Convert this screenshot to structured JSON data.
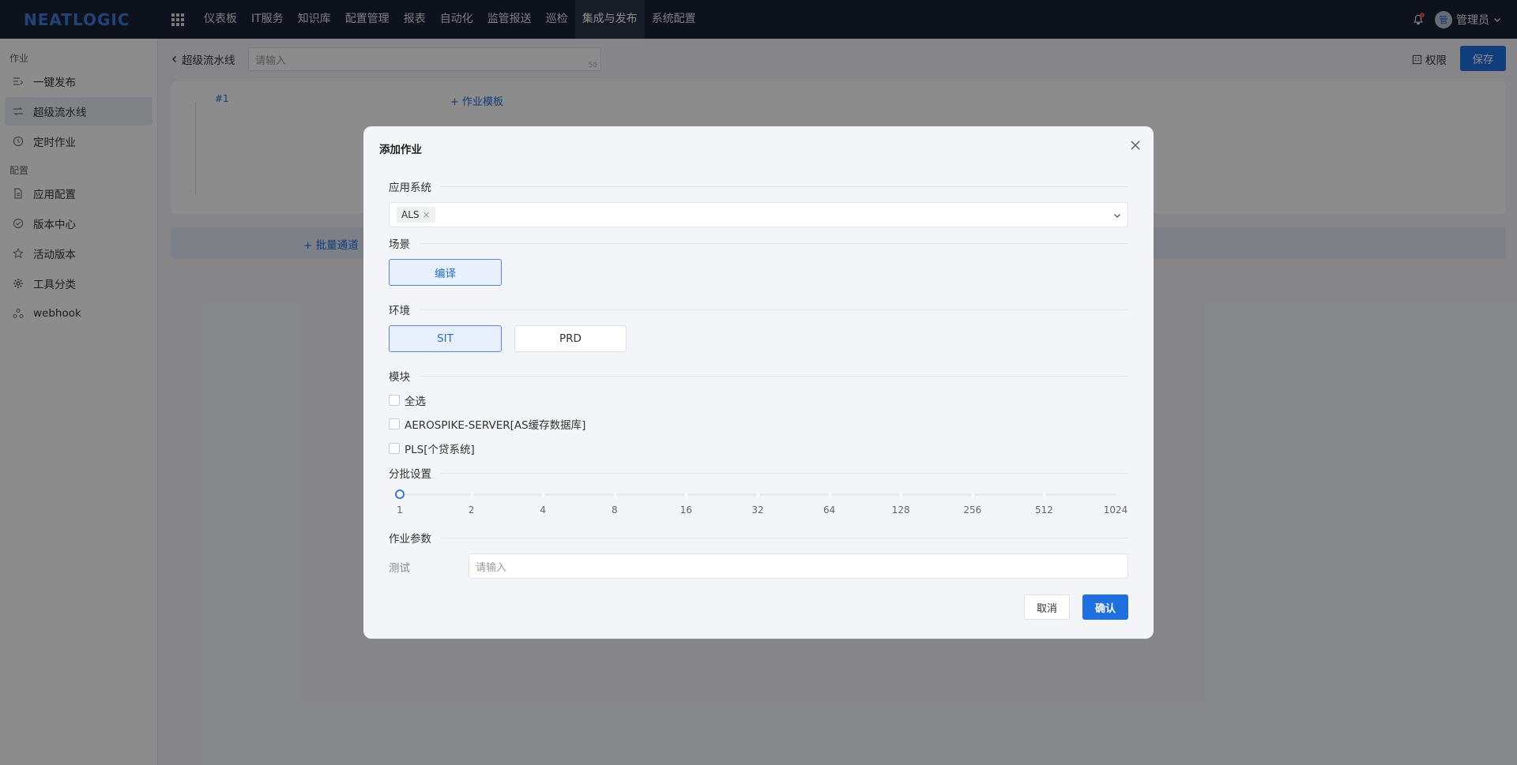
{
  "topbar": {
    "logo": "NEATLOGIC",
    "nav": [
      "仪表板",
      "IT服务",
      "知识库",
      "配置管理",
      "报表",
      "自动化",
      "监管报送",
      "巡检",
      "集成与发布",
      "系统配置"
    ],
    "active_nav": "集成与发布",
    "user_avatar": "管",
    "user_name": "管理员"
  },
  "sidebar": {
    "group1": "作业",
    "items1": [
      {
        "label": "一键发布",
        "icon": "publish-icon"
      },
      {
        "label": "超级流水线",
        "icon": "pipeline-icon",
        "active": true
      },
      {
        "label": "定时作业",
        "icon": "clock-icon"
      }
    ],
    "group2": "配置",
    "items2": [
      {
        "label": "应用配置",
        "icon": "file-icon"
      },
      {
        "label": "版本中心",
        "icon": "check-circle-icon"
      },
      {
        "label": "活动版本",
        "icon": "star-icon"
      },
      {
        "label": "工具分类",
        "icon": "gear-icon"
      },
      {
        "label": "webhook",
        "icon": "webhook-icon"
      }
    ]
  },
  "main": {
    "back_label": "超级流水线",
    "title_placeholder": "请输入",
    "title_count": "50",
    "permission_label": "权限",
    "save_label": "保存",
    "stage_number": "#1",
    "template_link": "+ 作业模板",
    "batch_channel": "+ 批量通道"
  },
  "modal": {
    "title": "添加作业",
    "app_system_label": "应用系统",
    "app_system_tag": "ALS",
    "scene_label": "场景",
    "scene_options": [
      {
        "label": "编译",
        "selected": true
      }
    ],
    "env_label": "环境",
    "env_options": [
      {
        "label": "SIT",
        "selected": true
      },
      {
        "label": "PRD",
        "selected": false
      }
    ],
    "module_label": "模块",
    "modules": [
      "全选",
      "AEROSPIKE-SERVER[AS缓存数据库]",
      "PLS[个贷系统]"
    ],
    "batch_label": "分批设置",
    "batch_ticks": [
      "1",
      "2",
      "4",
      "8",
      "16",
      "32",
      "64",
      "128",
      "256",
      "512",
      "1024"
    ],
    "batch_value": "1",
    "params_label": "作业参数",
    "param_name": "测试",
    "param_placeholder": "请输入",
    "cancel_label": "取消",
    "confirm_label": "确认"
  },
  "colors": {
    "topbar_bg": "#1b2234",
    "primary": "#1e6fe0",
    "selected_bg": "#e8f0fd"
  }
}
